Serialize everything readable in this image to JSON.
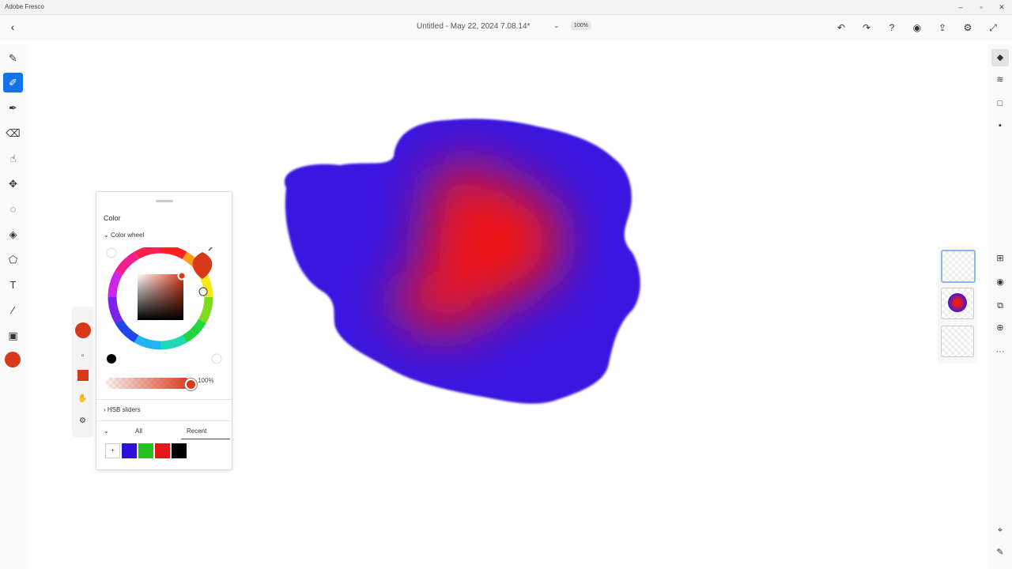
{
  "app": {
    "title": "Adobe Fresco"
  },
  "window_controls": {
    "minimize": "–",
    "maximize": "▫",
    "close": "✕"
  },
  "topbar": {
    "back": "‹",
    "doc_title": "Untitled - May 22, 2024 7.08.14*",
    "chevron": "⌄",
    "zoom": "100%",
    "actions": [
      {
        "name": "undo",
        "icon": "↶"
      },
      {
        "name": "redo",
        "icon": "↷"
      },
      {
        "name": "help",
        "icon": "?"
      },
      {
        "name": "livestream",
        "icon": "◉"
      },
      {
        "name": "share",
        "icon": "⇪"
      },
      {
        "name": "settings",
        "icon": "⚙"
      },
      {
        "name": "fullscreen",
        "icon": "⤢"
      }
    ]
  },
  "left_toolbar": {
    "tools": [
      {
        "name": "pixel-brush",
        "icon": "✎"
      },
      {
        "name": "live-brush",
        "icon": "✐",
        "active": true
      },
      {
        "name": "vector-brush",
        "icon": "✒"
      },
      {
        "name": "eraser",
        "icon": "⌫"
      },
      {
        "name": "smudge",
        "icon": "☝"
      },
      {
        "name": "move",
        "icon": "✥"
      },
      {
        "name": "lasso",
        "icon": "◌"
      },
      {
        "name": "fill",
        "icon": "◈"
      },
      {
        "name": "shapes",
        "icon": "⬠"
      },
      {
        "name": "text",
        "icon": "T"
      },
      {
        "name": "eyedropper",
        "icon": "⁄"
      },
      {
        "name": "image",
        "icon": "▣"
      }
    ],
    "color": "#d9391b"
  },
  "right_toolbar": {
    "tools": [
      {
        "name": "layers",
        "icon": "◆",
        "selected": true
      },
      {
        "name": "layer-properties",
        "icon": "≋"
      },
      {
        "name": "canvas",
        "icon": "□"
      },
      {
        "name": "comments",
        "icon": "▪"
      }
    ],
    "layer_actions": [
      {
        "name": "add-layer",
        "icon": "⊞"
      },
      {
        "name": "visibility",
        "icon": "◉"
      },
      {
        "name": "duplicate",
        "icon": "⧉"
      },
      {
        "name": "lock",
        "icon": "⊕"
      },
      {
        "name": "more",
        "icon": "···"
      }
    ],
    "bottom": [
      {
        "name": "touch-shortcut",
        "icon": "⌖"
      },
      {
        "name": "pencil",
        "icon": "✎"
      }
    ]
  },
  "side_rail": {
    "items": [
      {
        "name": "color-swatch",
        "icon": ""
      },
      {
        "name": "brush-size",
        "icon": "▫"
      },
      {
        "name": "square",
        "icon": ""
      },
      {
        "name": "thumb",
        "icon": "✋"
      },
      {
        "name": "settings",
        "icon": "⚙"
      }
    ]
  },
  "color_panel": {
    "title": "Color",
    "section_header": "Color wheel",
    "current_color": "#d9391b",
    "opacity": "100%",
    "opacity_fraction": 1.0,
    "hsb_label": "HSB sliders",
    "tabs": [
      "All",
      "Recent"
    ],
    "active_tab": "Recent",
    "add_swatch": "+",
    "swatches": [
      "#2d13d6",
      "#22c31f",
      "#e31919",
      "#000000"
    ]
  }
}
